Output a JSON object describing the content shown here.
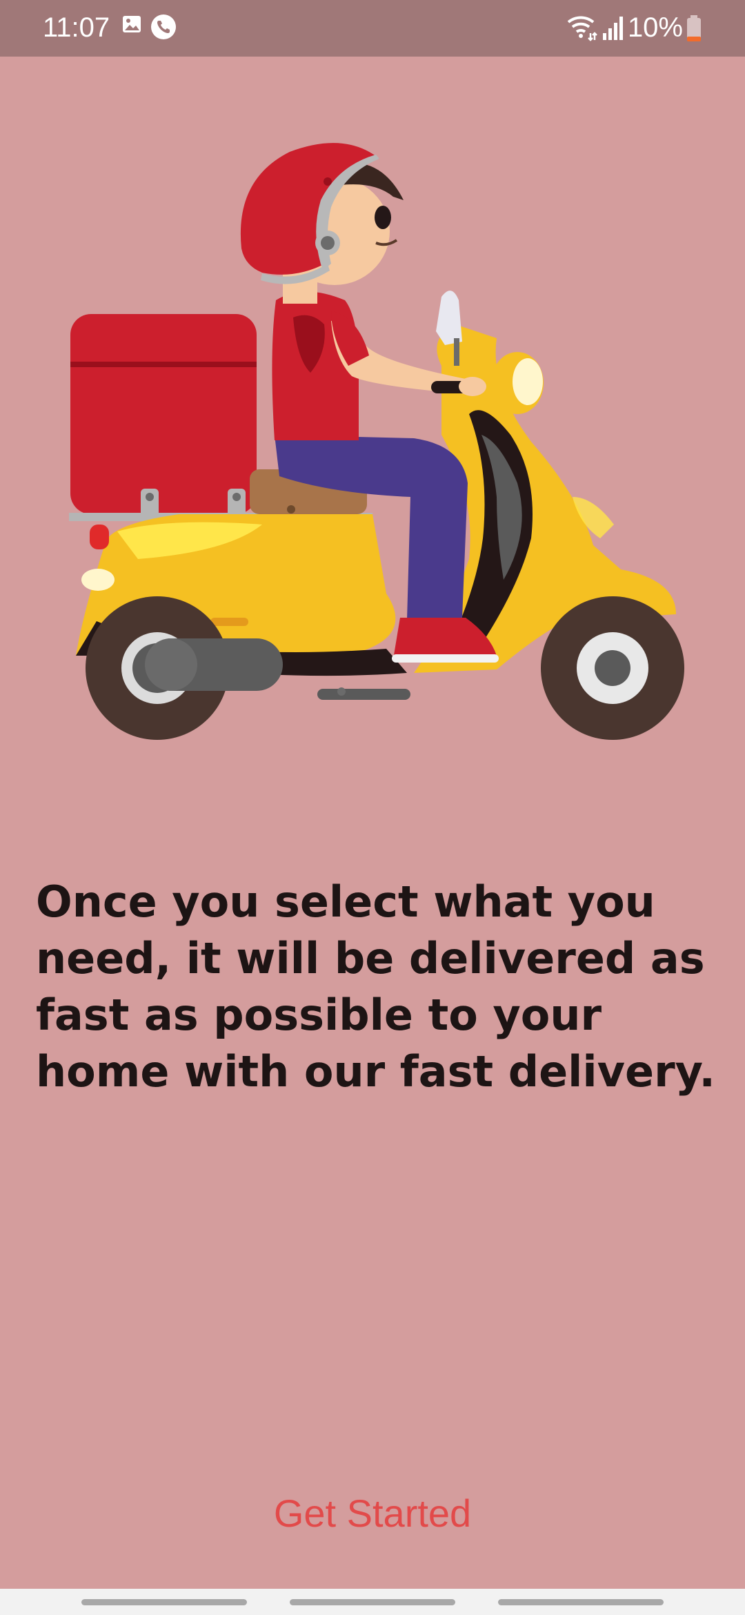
{
  "status_bar": {
    "time": "11:07",
    "battery": "10%",
    "icons": [
      "image-icon",
      "phone-icon",
      "wifi-icon",
      "signal-icon",
      "battery-icon"
    ]
  },
  "illustration": {
    "icon": "delivery-scooter-illustration"
  },
  "content": {
    "message": "Once you select what you need, it will be delivered as fast as possible to your home with our fast delivery.",
    "get_started_label": "Get Started"
  },
  "colors": {
    "background": "#d49d9d",
    "status_bar": "#a07878",
    "accent": "#e24a4a",
    "text": "#1d1414"
  }
}
